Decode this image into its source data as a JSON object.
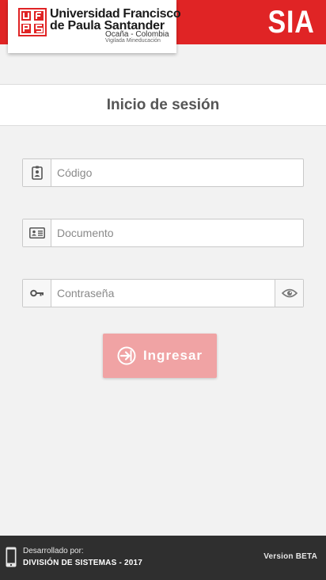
{
  "header": {
    "logo": {
      "line1": "Universidad Francisco",
      "line2": "de Paula Santander",
      "line3": "Ocaña - Colombia",
      "line4": "Vigilada Mineducación"
    },
    "app_name": "SIA",
    "brand_color": "#e02425"
  },
  "page": {
    "title": "Inicio de sesión"
  },
  "form": {
    "codigo": {
      "placeholder": "Código",
      "icon": "badge-icon"
    },
    "documento": {
      "placeholder": "Documento",
      "icon": "id-card-icon"
    },
    "contrasena": {
      "placeholder": "Contraseña",
      "icon": "key-icon",
      "toggle_icon": "eye-icon"
    },
    "submit": {
      "label": "Ingresar",
      "icon": "sign-in-icon",
      "color": "#f0a3a4"
    }
  },
  "footer": {
    "dev_label": "Desarrollado por:",
    "dev_team": "DIVISIÓN DE SISTEMAS - 2017",
    "version": "Version BETA",
    "icon": "mobile-phone-icon"
  }
}
